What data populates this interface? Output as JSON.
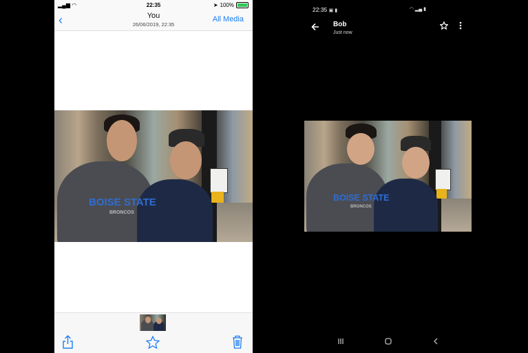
{
  "ios": {
    "status": {
      "time": "22:35",
      "battery": "100%"
    },
    "nav": {
      "back": "‹",
      "title": "You",
      "subtitle": "26/06/2019, 22:35",
      "all_media": "All Media"
    },
    "toolbar": {
      "share": "share-icon",
      "favorite": "star-icon",
      "delete": "trash-icon"
    }
  },
  "android": {
    "status": {
      "time": "22:35"
    },
    "header": {
      "name": "Bob",
      "subtitle": "Just now"
    },
    "icons": {
      "back": "arrow-left-icon",
      "star": "star-outline-icon",
      "more": "more-vert-icon"
    },
    "navbar": {
      "recents": "recents-icon",
      "home": "home-icon",
      "back": "back-icon"
    }
  },
  "photo": {
    "shirt_text": "BOISE STATE",
    "shirt_subtext": "BRONCOS"
  },
  "colors": {
    "ios_accent": "#1a7ef6",
    "android_bg": "#000000",
    "battery": "#34c759"
  }
}
